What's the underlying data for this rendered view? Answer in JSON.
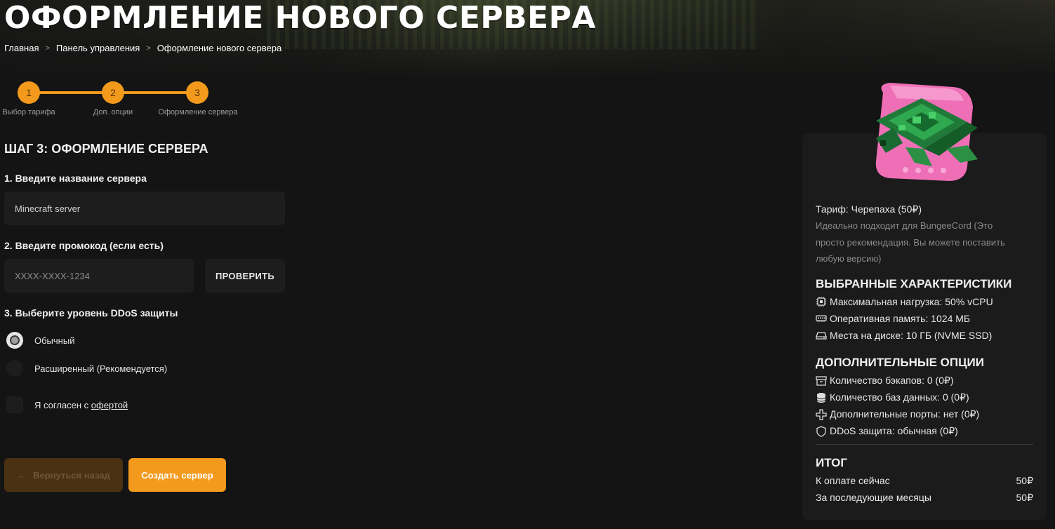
{
  "header": {
    "title": "ОФОРМЛЕНИЕ НОВОГО СЕРВЕРА",
    "breadcrumb": [
      "Главная",
      "Панель управления",
      "Оформление нового сервера"
    ]
  },
  "stepper": {
    "steps": [
      {
        "number": "1",
        "label": "Выбор тарифа"
      },
      {
        "number": "2",
        "label": "Доп. опции"
      },
      {
        "number": "3",
        "label": "Оформление сервера"
      }
    ],
    "current_step": 3,
    "accent_color": "#f39a1c"
  },
  "form": {
    "heading": "ШАГ 3: ОФОРМЛЕНИЕ СЕРВЕРА",
    "name_label": "1. Введите название сервера",
    "name_value": "Minecraft server",
    "promo_label": "2. Введите промокод (если есть)",
    "promo_placeholder": "XXXX-XXXX-1234",
    "check_button": "ПРОВЕРИТЬ",
    "ddos_label": "3. Выберите уровень DDoS защиты",
    "ddos_options": [
      {
        "label": "Обычный",
        "selected": true
      },
      {
        "label": "Расширенный (Рекомендуется)",
        "selected": false
      }
    ],
    "agree_text": "Я согласен с ",
    "agree_link": "офертой",
    "agree_checked": false,
    "back_button": "Вернуться назад",
    "create_button": "Создать сервер"
  },
  "summary": {
    "tariff": "Тариф: Черепаха (50₽)",
    "note": "Идеально подходит для BungeeCord (Это просто рекомендация. Вы можете поставить любую версию)",
    "specs_title": "ВЫБРАННЫЕ ХАРАКТЕРИСТИКИ",
    "specs": [
      {
        "icon": "cpu-icon",
        "text": "Максимальная нагрузка: 50% vCPU"
      },
      {
        "icon": "memory-icon",
        "text": "Оперативная память: 1024 МБ"
      },
      {
        "icon": "disk-icon",
        "text": "Места на диске: 10 ГБ (NVME SSD)"
      }
    ],
    "options_title": "ДОПОЛНИТЕЛЬНЫЕ ОПЦИИ",
    "options": [
      {
        "icon": "archive-icon",
        "text": "Количество бэкапов: 0 (0₽)"
      },
      {
        "icon": "database-icon",
        "text": "Количество баз данных: 0 (0₽)"
      },
      {
        "icon": "plus-icon",
        "text": "Дополнительные порты: нет (0₽)"
      },
      {
        "icon": "shield-icon",
        "text": "DDoS защита: обычная (0₽)"
      }
    ],
    "total_title": "ИТОГ",
    "totals": [
      {
        "label": "К оплате сейчас",
        "value": "50₽"
      },
      {
        "label": "За последующие месяцы",
        "value": "50₽"
      }
    ]
  }
}
